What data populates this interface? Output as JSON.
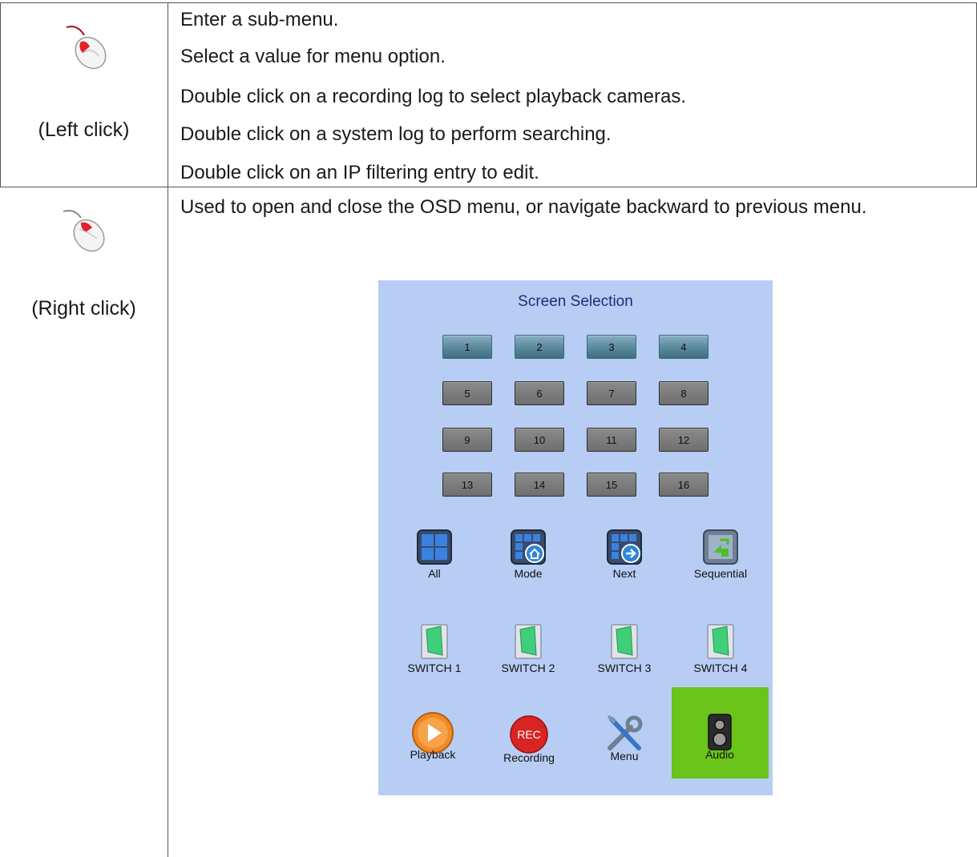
{
  "rows": [
    {
      "action": "(Left click)",
      "icon": "mouse-left-click-icon",
      "lines": [
        "Enter a sub-menu.",
        "Select a value for menu option.",
        "Double click on a recording log to select playback cameras.",
        "Double click on a system log to perform searching.",
        "Double click on an IP filtering entry to edit."
      ]
    },
    {
      "action": "(Right click)",
      "icon": "mouse-right-click-icon",
      "description": "Used to open and close the OSD menu, or navigate backward to previous menu."
    }
  ],
  "osd": {
    "title": "Screen Selection",
    "channels": [
      "1",
      "2",
      "3",
      "4",
      "5",
      "6",
      "7",
      "8",
      "9",
      "10",
      "11",
      "12",
      "13",
      "14",
      "15",
      "16"
    ],
    "active_channels": [
      "1",
      "2",
      "3",
      "4"
    ],
    "view_tools": [
      {
        "label": "All",
        "icon": "all-grid-icon"
      },
      {
        "label": "Mode",
        "icon": "mode-grid-icon"
      },
      {
        "label": "Next",
        "icon": "next-grid-icon"
      },
      {
        "label": "Sequential",
        "icon": "sequential-icon"
      }
    ],
    "switches": [
      {
        "label": "SWITCH 1",
        "icon": "switch-icon"
      },
      {
        "label": "SWITCH 2",
        "icon": "switch-icon"
      },
      {
        "label": "SWITCH 3",
        "icon": "switch-icon"
      },
      {
        "label": "SWITCH 4",
        "icon": "switch-icon"
      }
    ],
    "actions": [
      {
        "label": "Playback",
        "icon": "play-icon"
      },
      {
        "label": "Recording",
        "icon": "rec-icon",
        "badge": "REC"
      },
      {
        "label": "Menu",
        "icon": "tools-icon"
      },
      {
        "label": "Audio",
        "icon": "speaker-icon",
        "highlighted": true
      }
    ],
    "colors": {
      "panel": "#b7cdf4",
      "title": "#1b2e7a",
      "audio_highlight": "#6ac419",
      "active_button": "#5d8aa0",
      "inactive_button": "#777777"
    }
  }
}
